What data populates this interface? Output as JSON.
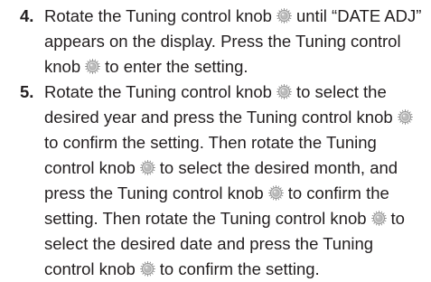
{
  "instructions": {
    "steps": [
      {
        "number": "4.",
        "segments": [
          {
            "type": "text",
            "value": "Rotate the Tuning control knob"
          },
          {
            "type": "icon",
            "icon": "tuning-knob-icon"
          },
          {
            "type": "text",
            "value": "until “DATE ADJ” appears on the display. Press the Tuning control knob"
          },
          {
            "type": "icon",
            "icon": "tuning-knob-icon"
          },
          {
            "type": "text",
            "value": "to enter the setting."
          }
        ]
      },
      {
        "number": "5.",
        "segments": [
          {
            "type": "text",
            "value": "Rotate the Tuning control knob"
          },
          {
            "type": "icon",
            "icon": "tuning-knob-icon"
          },
          {
            "type": "text",
            "value": "to select the desired year and press the Tuning control knob"
          },
          {
            "type": "icon",
            "icon": "tuning-knob-icon"
          },
          {
            "type": "text",
            "value": "to confirm the setting. Then rotate the Tuning control knob"
          },
          {
            "type": "icon",
            "icon": "tuning-knob-icon"
          },
          {
            "type": "text",
            "value": "to select the desired month, and press the Tuning control knob"
          },
          {
            "type": "icon",
            "icon": "tuning-knob-icon"
          },
          {
            "type": "text",
            "value": "to confirm the setting. Then rotate the Tuning control knob"
          },
          {
            "type": "icon",
            "icon": "tuning-knob-icon"
          },
          {
            "type": "text",
            "value": "to select the desired date and press the Tuning control knob"
          },
          {
            "type": "icon",
            "icon": "tuning-knob-icon"
          },
          {
            "type": "text",
            "value": "to confirm the setting."
          }
        ]
      }
    ]
  }
}
